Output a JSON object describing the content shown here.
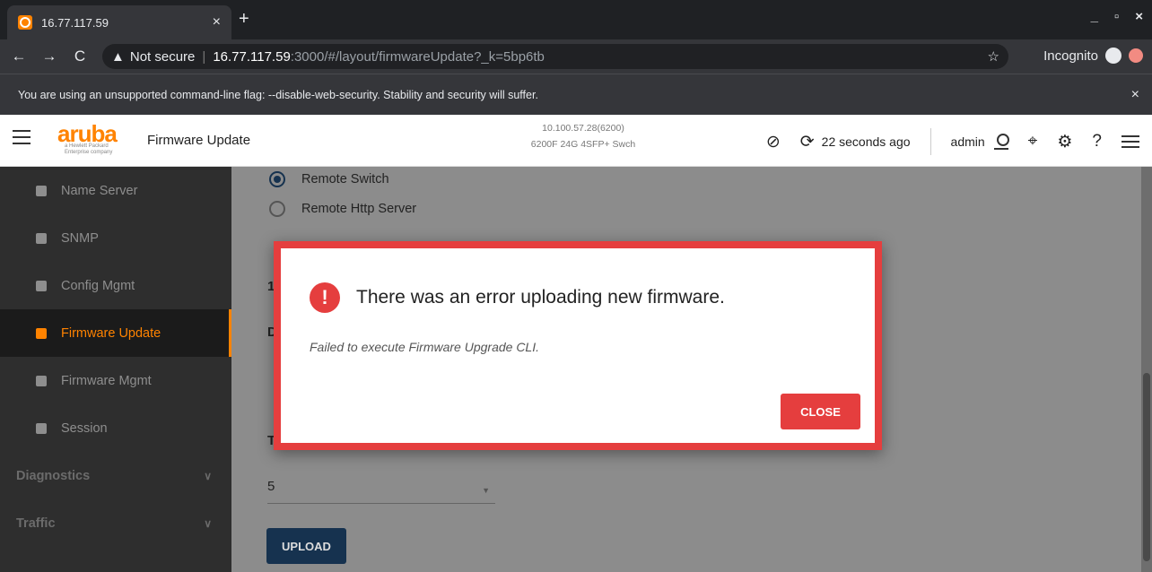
{
  "browser": {
    "tab_title": "16.77.117.59",
    "tab_close": "×",
    "new_tab": "+",
    "win_min": "_",
    "win_restore": "▫",
    "win_close": "×",
    "back": "←",
    "forward": "→",
    "reload": "C",
    "warn_glyph": "▲",
    "not_secure": "Not secure",
    "separator": "|",
    "url_host": "16.77.117.59",
    "url_path": ":3000/#/layout/firmwareUpdate?_k=5bp6tb",
    "star": "☆",
    "incognito": "Incognito",
    "infobar_text": "You are using an unsupported command-line flag: --disable-web-security. Stability and security will suffer.",
    "infobar_close": "×"
  },
  "header": {
    "logo_text": "aruba",
    "logo_sub": "a Hewlett Packard Enterprise company",
    "page_title": "Firmware Update",
    "device_ip": "10.100.57.28(6200)",
    "device_model": "6200F 24G 4SFP+ Swch",
    "refresh_text": "22 seconds ago",
    "username": "admin"
  },
  "sidebar": {
    "items": [
      {
        "label": "Name Server"
      },
      {
        "label": "SNMP"
      },
      {
        "label": "Config Mgmt"
      },
      {
        "label": "Firmware Update"
      },
      {
        "label": "Firmware Mgmt"
      },
      {
        "label": "Session"
      }
    ],
    "groups": [
      {
        "label": "Diagnostics"
      },
      {
        "label": "Traffic"
      }
    ]
  },
  "main": {
    "radio_remote_switch": "Remote Switch",
    "radio_remote_http": "Remote Http Server",
    "frag_1": "1",
    "frag_d": "D",
    "frag_t": "T",
    "timeout_value": "5",
    "upload_label": "UPLOAD"
  },
  "modal": {
    "icon_glyph": "!",
    "title": "There was an error uploading new firmware.",
    "message": "Failed to execute Firmware Upgrade CLI.",
    "close_label": "CLOSE"
  },
  "colors": {
    "accent": "#ff8300",
    "error": "#e53e3e",
    "button_dark": "#16324f"
  }
}
